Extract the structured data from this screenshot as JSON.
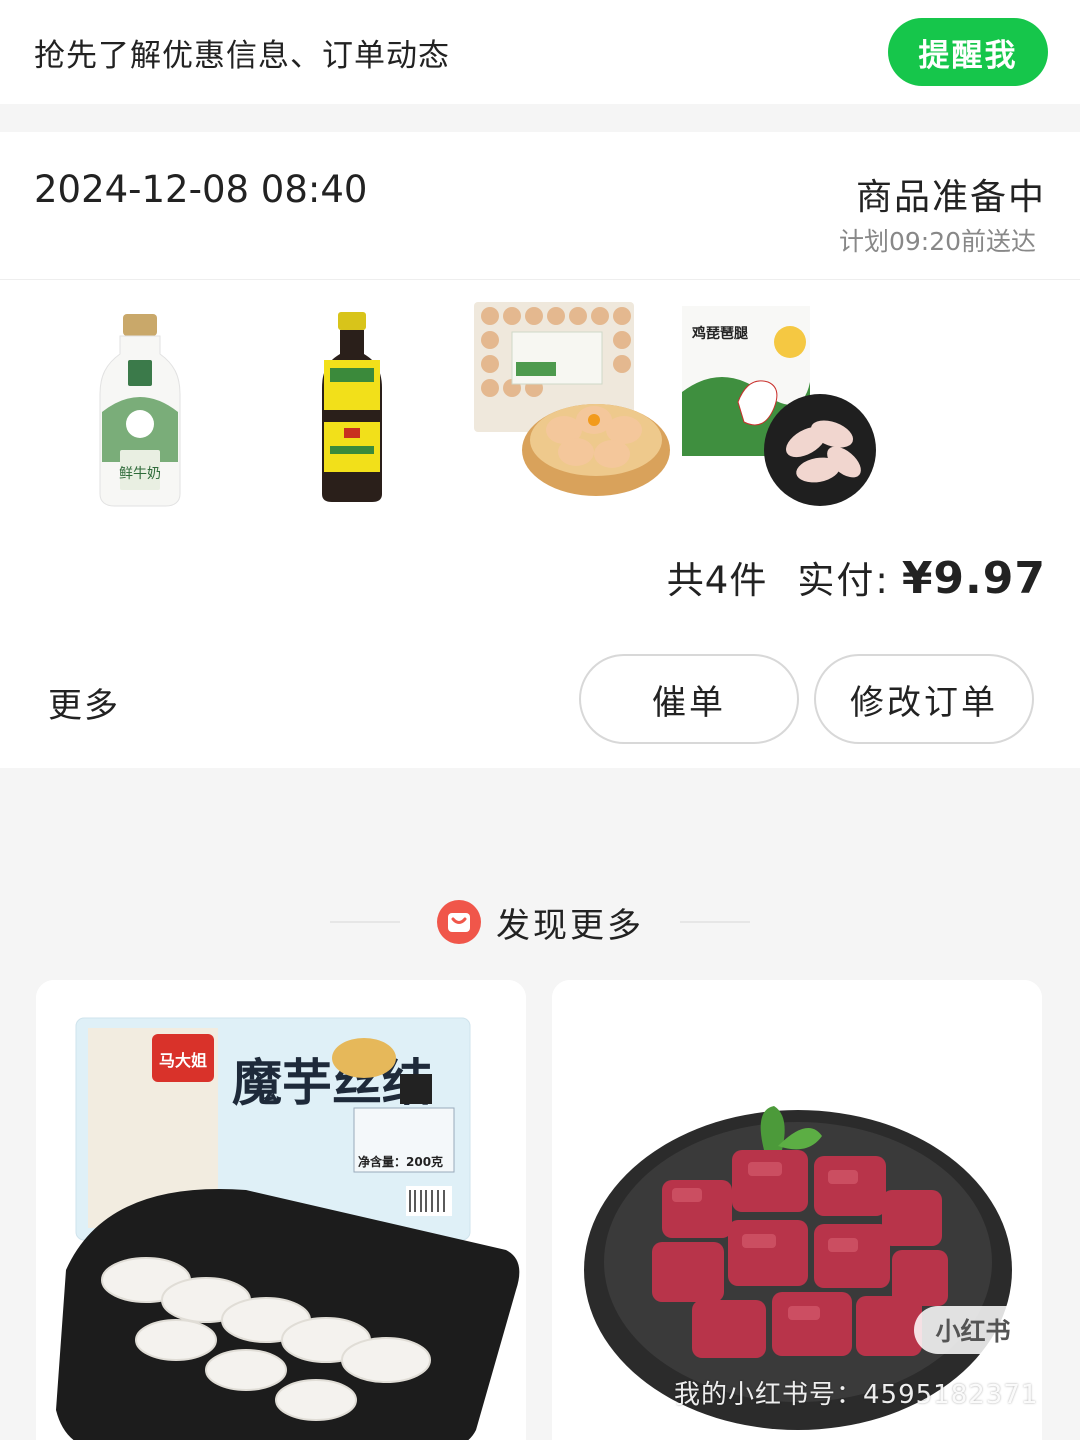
{
  "notify": {
    "text": "抢先了解优惠信息、订单动态",
    "button_label": "提醒我"
  },
  "order": {
    "time": "2024-12-08 08:40",
    "status": "商品准备中",
    "plan": "计划09:20前送达",
    "products": [
      {
        "icon": "milk-bottle",
        "label": "鲜牛奶"
      },
      {
        "icon": "oyster-sauce-bottle",
        "label": ""
      },
      {
        "icon": "egg-tray",
        "label": ""
      },
      {
        "icon": "chicken-drumstick",
        "label": "鸡琵琶腿"
      }
    ],
    "count_text": "共4件",
    "paid_label": "实付:",
    "price": "¥9.97",
    "more_label": "更多",
    "urge_label": "催单",
    "modify_label": "修改订单"
  },
  "discover": {
    "title": "发现更多",
    "icon": "shopping-bag-icon",
    "cards": [
      {
        "icon": "konjac-knot-package",
        "brand": "马大姐",
        "name": "魔芋丝结",
        "net_weight": "净含量：200克"
      },
      {
        "icon": "beef-cubes-plate"
      }
    ]
  },
  "watermark": {
    "badge": "小红书",
    "text": "我的小红书号：4595182371"
  },
  "colors": {
    "accent_green": "#16c64b",
    "discover_icon_red": "#f0564a"
  }
}
